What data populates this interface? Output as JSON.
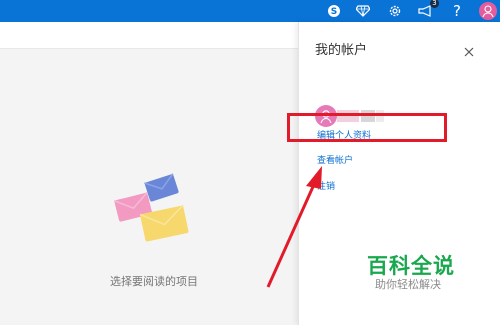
{
  "topbar": {
    "badge_count": "3",
    "icons": [
      "skype-icon",
      "diamond-icon",
      "settings-gear-icon",
      "megaphone-icon",
      "help-icon",
      "avatar-icon"
    ],
    "color": "#0a73d6"
  },
  "main": {
    "empty_state_text": "选择要阅读的项目"
  },
  "account_panel": {
    "title": "我的帐户",
    "links": {
      "edit_profile": "编辑个人资料",
      "view_account": "查看帐户",
      "sign_out": "注销"
    },
    "link_color": "#0b6fd1"
  },
  "watermark": {
    "brand": "百科全说",
    "tagline": "助你轻松解决"
  },
  "annotation": {
    "highlight_color": "#e21b2b"
  }
}
